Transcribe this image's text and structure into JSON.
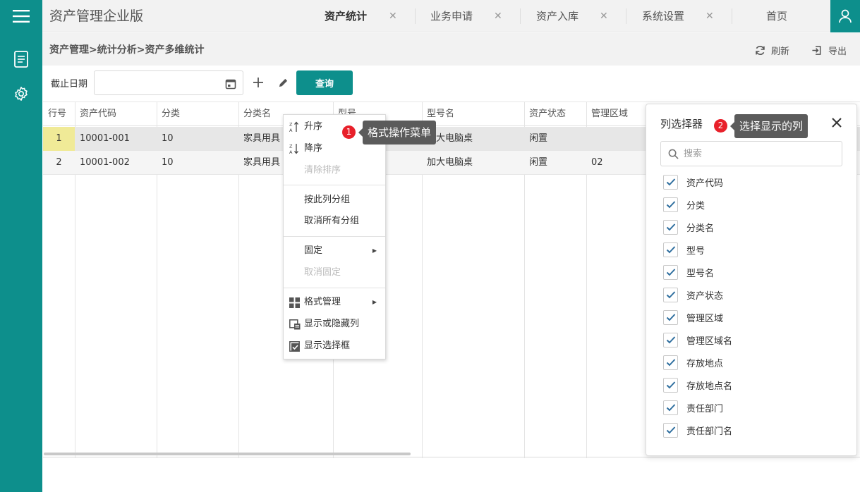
{
  "app": {
    "title": "资产管理企业版"
  },
  "tabs": [
    {
      "label": "资产统计",
      "active": true
    },
    {
      "label": "业务申请",
      "active": false
    },
    {
      "label": "资产入库",
      "active": false
    },
    {
      "label": "系统设置",
      "active": false
    },
    {
      "label": "首页",
      "active": false
    }
  ],
  "breadcrumb": "资产管理>统计分析>资产多维统计",
  "actions": {
    "refresh": "刷新",
    "export": "导出"
  },
  "filter": {
    "label": "截止日期",
    "date_value": "",
    "query_label": "查询"
  },
  "grid": {
    "columns": [
      "行号",
      "资产代码",
      "分类",
      "分类名",
      "型号",
      "型号名",
      "资产状态",
      "管理区域"
    ],
    "rows": [
      {
        "row_no": "1",
        "code": "10001-001",
        "category": "10",
        "category_name": "家具用具",
        "model": "",
        "model_name": "加大电脑桌",
        "status": "闲置",
        "area": ""
      },
      {
        "row_no": "2",
        "code": "10001-002",
        "category": "10",
        "category_name": "家具用具",
        "model": "",
        "model_name": "加大电脑桌",
        "status": "闲置",
        "area": "02"
      }
    ]
  },
  "context_menu": {
    "items": [
      {
        "label": "升序",
        "disabled": false
      },
      {
        "label": "降序",
        "disabled": false
      },
      {
        "label": "清除排序",
        "disabled": true
      },
      {
        "label": "按此列分组",
        "disabled": false
      },
      {
        "label": "取消所有分组",
        "disabled": false
      },
      {
        "label": "固定",
        "disabled": false
      },
      {
        "label": "取消固定",
        "disabled": true
      },
      {
        "label": "格式管理",
        "disabled": false
      },
      {
        "label": "显示或隐藏列",
        "disabled": false
      },
      {
        "label": "显示选择框",
        "disabled": false
      }
    ]
  },
  "callouts": [
    {
      "number": "1",
      "text": "格式操作菜单"
    },
    {
      "number": "2",
      "text": "选择显示的列"
    }
  ],
  "column_selector": {
    "title": "列选择器",
    "search_placeholder": "搜索",
    "items": [
      {
        "label": "资产代码",
        "checked": true
      },
      {
        "label": "分类",
        "checked": true
      },
      {
        "label": "分类名",
        "checked": true
      },
      {
        "label": "型号",
        "checked": true
      },
      {
        "label": "型号名",
        "checked": true
      },
      {
        "label": "资产状态",
        "checked": true
      },
      {
        "label": "管理区域",
        "checked": true
      },
      {
        "label": "管理区域名",
        "checked": true
      },
      {
        "label": "存放地点",
        "checked": true
      },
      {
        "label": "存放地点名",
        "checked": true
      },
      {
        "label": "责任部门",
        "checked": true
      },
      {
        "label": "责任部门名",
        "checked": true
      }
    ]
  },
  "colors": {
    "brand": "#0d8f8c",
    "badge": "#e8202a",
    "tooltip": "#5b5b5b",
    "selected_row_number": "#f0ea97"
  },
  "icons": {
    "menu": "hamburger-icon",
    "nav": [
      "document-icon",
      "gear-icon"
    ],
    "user": "user-icon",
    "refresh": "refresh-icon",
    "export": "export-icon",
    "calendar": "calendar-icon",
    "add": "plus-icon",
    "edit": "pencil-icon",
    "search": "search-icon",
    "close": "close-icon"
  }
}
